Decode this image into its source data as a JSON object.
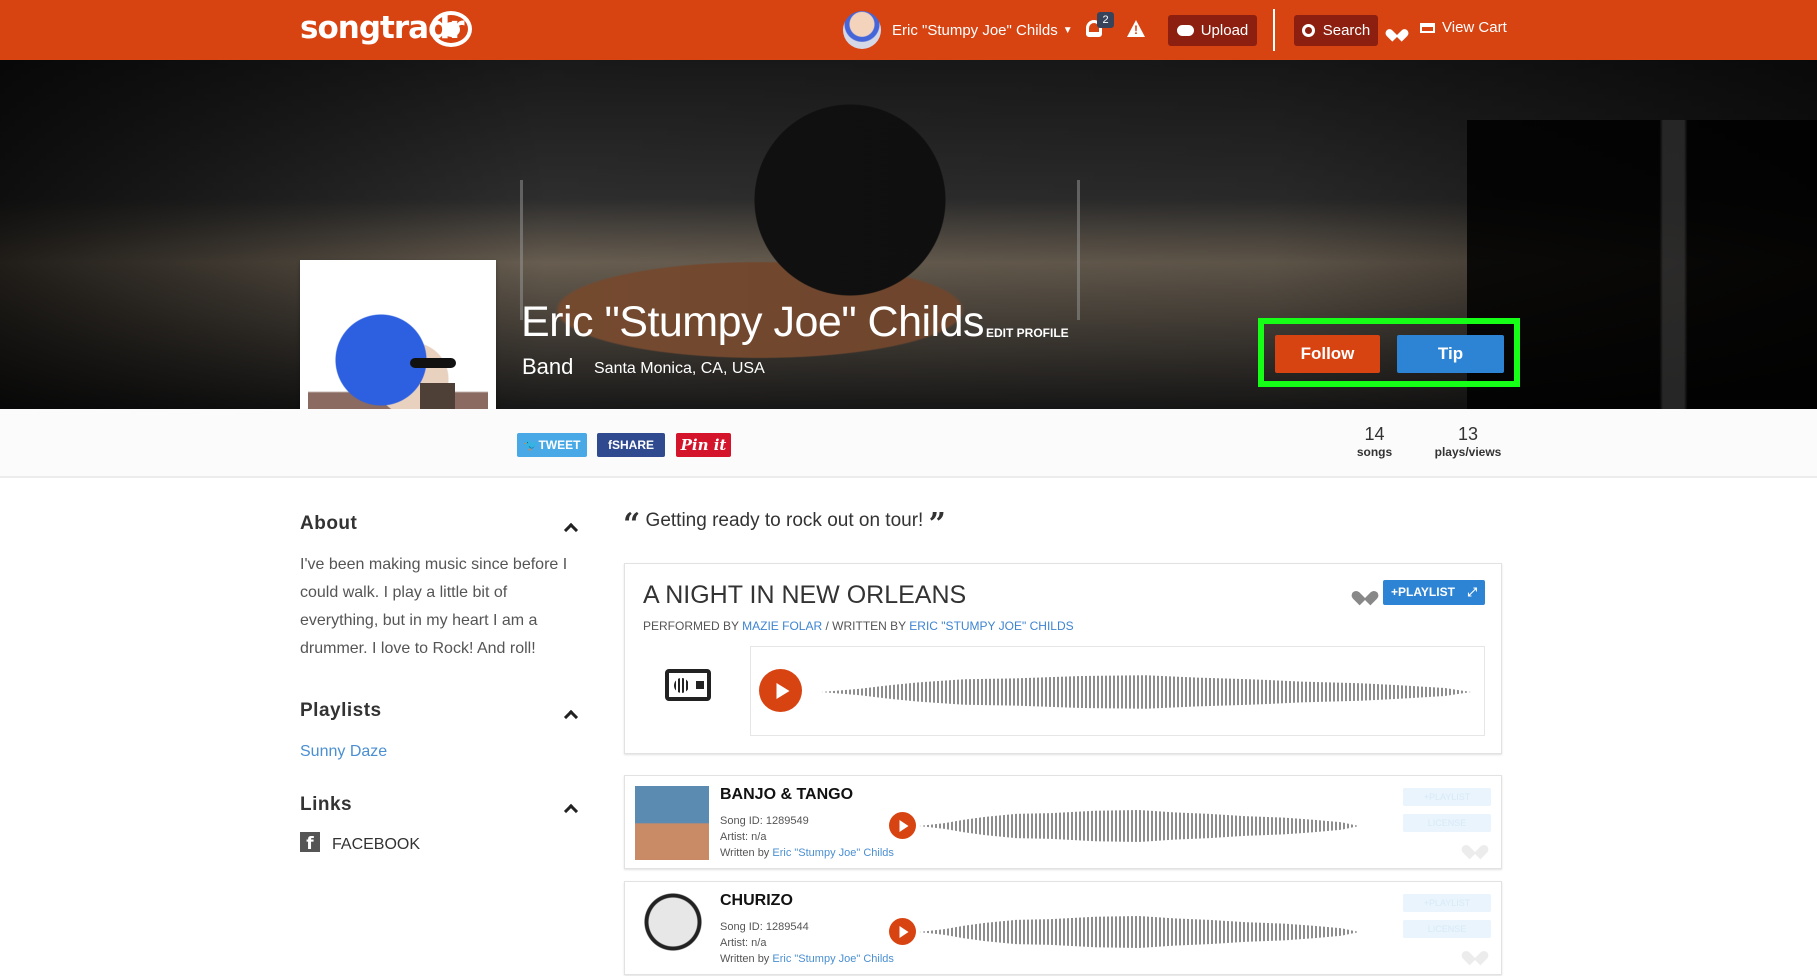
{
  "header": {
    "logo": "songtradr",
    "user_name": "Eric \"Stumpy Joe\" Childs",
    "notification_count": "2",
    "upload_label": "Upload",
    "search_label": "Search",
    "cart_label": "View Cart",
    "brand_color": "#d84312"
  },
  "profile": {
    "name": "Eric \"Stumpy Joe\" Childs",
    "edit_label": "EDIT PROFILE",
    "type": "Band",
    "location": "Santa Monica, CA, USA",
    "follow_label": "Follow",
    "tip_label": "Tip",
    "highlight_color": "#16ff16"
  },
  "social": {
    "tweet_label": "TWEET",
    "share_label": "SHARE",
    "pin_label": "Pin it"
  },
  "stats": [
    {
      "value": "14",
      "label": "songs"
    },
    {
      "value": "13",
      "label": "plays/views"
    }
  ],
  "sidebar": {
    "about_title": "About",
    "about_text": "I've been making music since before I could walk. I play a little bit of everything, but in my heart I am a drummer. I love to Rock! And roll!",
    "playlists_title": "Playlists",
    "playlist_item": "Sunny Daze",
    "links_title": "Links",
    "facebook_label": "FACEBOOK"
  },
  "main": {
    "quote": "Getting ready to rock out on tour!",
    "featured": {
      "title": "A NIGHT IN NEW ORLEANS",
      "performed_prefix": "PERFORMED BY",
      "performer": "MAZIE FOLAR",
      "written_prefix": "/ WRITTEN BY",
      "writer": "ERIC \"STUMPY JOE\" CHILDS",
      "playlist_label": "+PLAYLIST"
    },
    "songs": [
      {
        "title": "BANJO & TANGO",
        "song_id": "Song ID: 1289549",
        "artist": "Artist: n/a",
        "written_prefix": "Written by",
        "writer": "Eric \"Stumpy Joe\" Childs",
        "playlist_label": "+PLAYLIST",
        "license_label": "LICENSE"
      },
      {
        "title": "CHURIZO",
        "song_id": "Song ID: 1289544",
        "artist": "Artist: n/a",
        "written_prefix": "Written by",
        "writer": "Eric \"Stumpy Joe\" Childs",
        "playlist_label": "+PLAYLIST",
        "license_label": "LICENSE"
      }
    ]
  }
}
